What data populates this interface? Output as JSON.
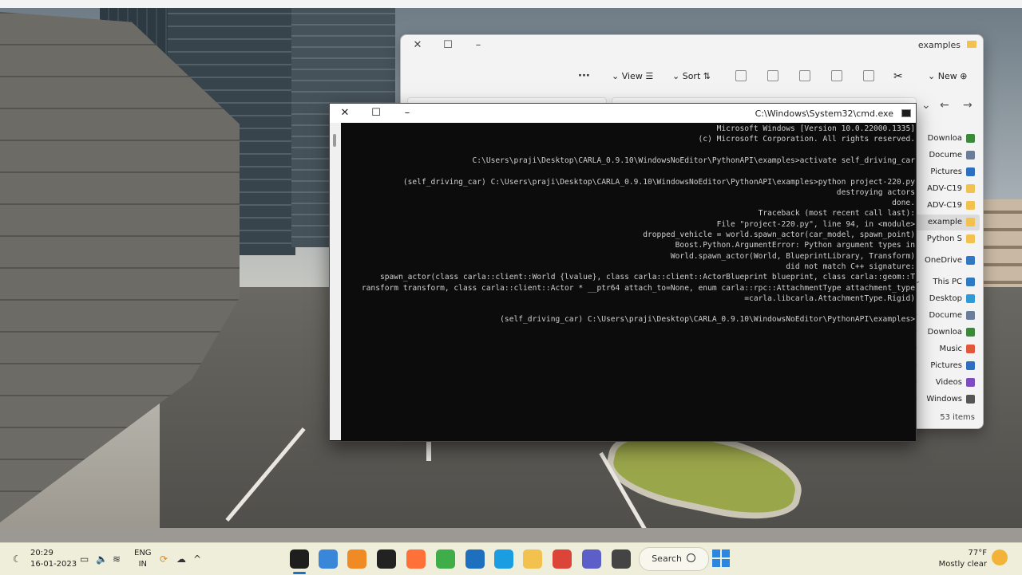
{
  "explorer": {
    "title": "examples",
    "toolbar": {
      "new_label": "New",
      "sort_label": "Sort",
      "view_label": "View",
      "more_label": "···"
    },
    "nav_items": [
      {
        "label": "Downloa",
        "icon": "download-icon",
        "color": "#3a8a3a"
      },
      {
        "label": "Docume",
        "icon": "document-icon",
        "color": "#6b7d9a"
      },
      {
        "label": "Pictures",
        "icon": "pictures-icon",
        "color": "#2f6fbf"
      },
      {
        "label": "ADV-C19",
        "icon": "folder-icon",
        "color": "#f2c14e"
      },
      {
        "label": "ADV-C19",
        "icon": "folder-icon",
        "color": "#f2c14e"
      },
      {
        "label": "example",
        "icon": "folder-icon",
        "color": "#f2c14e"
      },
      {
        "label": "Python S",
        "icon": "folder-icon",
        "color": "#f2c14e"
      },
      {
        "label": "OneDrive",
        "icon": "cloud-icon",
        "color": "#2f78c4"
      },
      {
        "label": "This PC",
        "icon": "computer-icon",
        "color": "#2f78c4"
      },
      {
        "label": "Desktop",
        "icon": "desktop-icon",
        "color": "#2f9ad8"
      },
      {
        "label": "Docume",
        "icon": "document-icon",
        "color": "#6b7d9a"
      },
      {
        "label": "Downloa",
        "icon": "download-icon",
        "color": "#3a8a3a"
      },
      {
        "label": "Music",
        "icon": "music-icon",
        "color": "#e0573c"
      },
      {
        "label": "Pictures",
        "icon": "pictures-icon",
        "color": "#2f6fbf"
      },
      {
        "label": "Videos",
        "icon": "videos-icon",
        "color": "#7d4bc4"
      },
      {
        "label": "Windows",
        "icon": "drive-icon",
        "color": "#555555"
      }
    ],
    "status": "53 items"
  },
  "cmd": {
    "title": "C:\\Windows\\System32\\cmd.exe",
    "lines": [
      "Microsoft Windows [Version 10.0.22000.1335]",
      "(c) Microsoft Corporation. All rights reserved.",
      "",
      "C:\\Users\\praji\\Desktop\\CARLA_0.9.10\\WindowsNoEditor\\PythonAPI\\examples>activate self_driving_car",
      "",
      "(self_driving_car) C:\\Users\\praji\\Desktop\\CARLA_0.9.10\\WindowsNoEditor\\PythonAPI\\examples>python project-220.py",
      "destroying actors",
      "done.",
      "Traceback (most recent call last):",
      "  File \"project-220.py\", line 94, in <module>",
      "    dropped_vehicle = world.spawn_actor(car_model, spawn_point)",
      "Boost.Python.ArgumentError: Python argument types in",
      "    World.spawn_actor(World, BlueprintLibrary, Transform)",
      "did not match C++ signature:",
      "    spawn_actor(class carla::client::World {lvalue}, class carla::client::ActorBlueprint blueprint, class carla::geom::T",
      "ransform transform, class carla::client::Actor * __ptr64 attach_to=None, enum carla::rpc::AttachmentType attachment_type",
      "=carla.libcarla.AttachmentType.Rigid)",
      "",
      "(self_driving_car) C:\\Users\\praji\\Desktop\\CARLA_0.9.10\\WindowsNoEditor\\PythonAPI\\examples>"
    ]
  },
  "taskbar": {
    "weather_temp": "77°F",
    "weather_desc": "Mostly clear",
    "search_label": "Search",
    "lang_line1": "ENG",
    "lang_line2": "IN",
    "time": "20:29",
    "date": "16-01-2023",
    "apps": [
      {
        "name": "cmd-app",
        "color": "#1e1e1e"
      },
      {
        "name": "notepad-app",
        "color": "#3a86d9"
      },
      {
        "name": "sublime-app",
        "color": "#f08a24"
      },
      {
        "name": "unreal-app",
        "color": "#222222"
      },
      {
        "name": "firefox-app",
        "color": "#ff7139"
      },
      {
        "name": "app-green",
        "color": "#3fae49"
      },
      {
        "name": "store-app",
        "color": "#1f6fbf"
      },
      {
        "name": "edge-app",
        "color": "#1b9de2"
      },
      {
        "name": "file-explorer-app",
        "color": "#f2c14e"
      },
      {
        "name": "chrome-app",
        "color": "#db4437"
      },
      {
        "name": "teams-app",
        "color": "#5b5fc7"
      },
      {
        "name": "app-window",
        "color": "#444444"
      }
    ]
  }
}
